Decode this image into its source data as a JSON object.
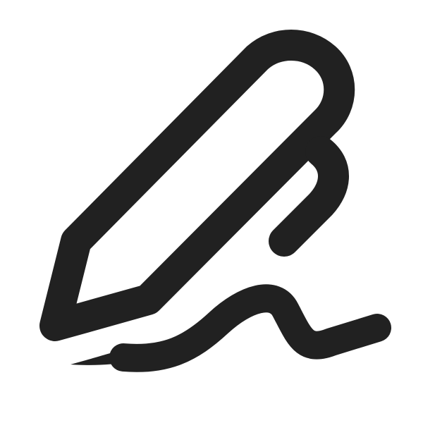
{
  "icon": {
    "name": "signature-icon",
    "parts": [
      "pen-icon",
      "signature-stroke"
    ],
    "color": "#212121",
    "background": "#ffffff"
  }
}
